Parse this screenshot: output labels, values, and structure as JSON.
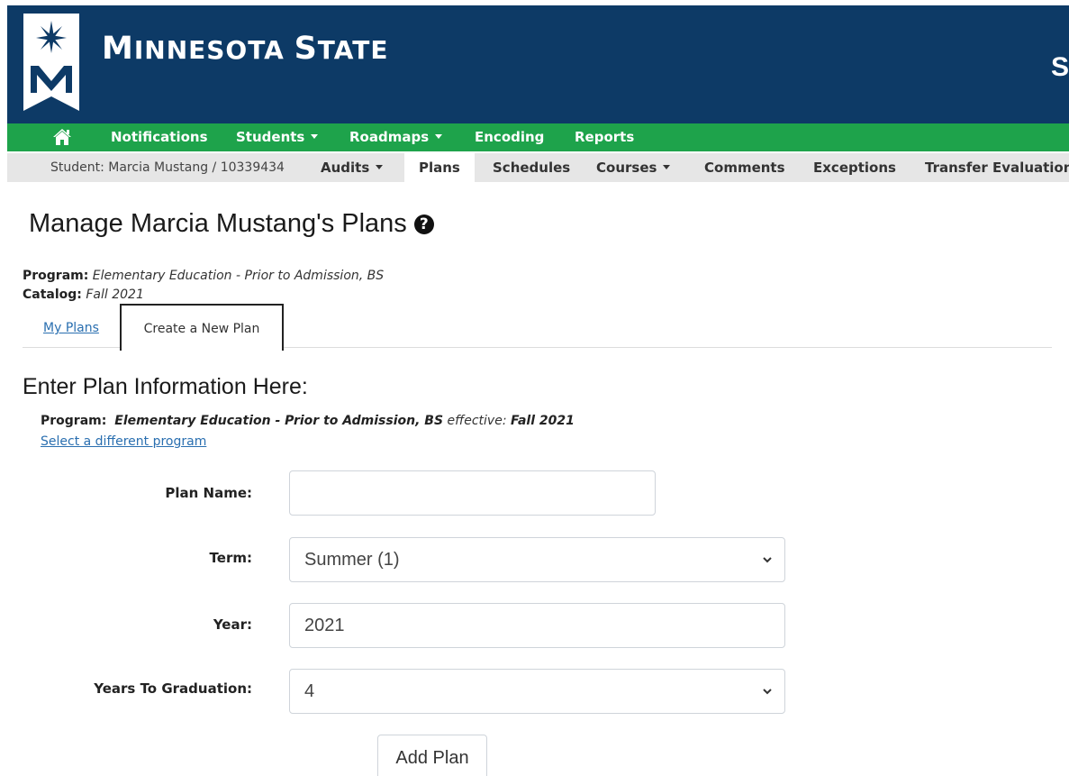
{
  "brand": {
    "name_first": "M",
    "name_rest": "INNESOTA ",
    "name_second": "S",
    "name_second_rest": "TATE",
    "edge_glyph": "S"
  },
  "green_nav": {
    "items": [
      {
        "label": "Notifications",
        "has_menu": false
      },
      {
        "label": "Students",
        "has_menu": true
      },
      {
        "label": "Roadmaps",
        "has_menu": true
      },
      {
        "label": "Encoding",
        "has_menu": false
      },
      {
        "label": "Reports",
        "has_menu": false
      }
    ]
  },
  "sub_nav": {
    "student": "Student: Marcia Mustang / 10339434",
    "items": [
      {
        "label": "Audits",
        "has_menu": true
      },
      {
        "label": "Plans",
        "active": true
      },
      {
        "label": "Schedules"
      },
      {
        "label": "Courses",
        "has_menu": true
      },
      {
        "label": "Comments"
      },
      {
        "label": "Exceptions"
      },
      {
        "label": "Transfer Evaluations"
      }
    ]
  },
  "page": {
    "title": "Manage Marcia Mustang's Plans",
    "help_glyph": "?",
    "program_label": "Program:",
    "program_value": "Elementary Education - Prior to Admission, BS",
    "catalog_label": "Catalog:",
    "catalog_value": "Fall 2021"
  },
  "tabs": {
    "my_plans": "My Plans",
    "create": "Create a New Plan"
  },
  "form": {
    "section_title": "Enter Plan Information Here:",
    "program_label": "Program:",
    "program_value": "Elementary Education - Prior to Admission, BS",
    "effective_label": "effective:",
    "effective_value": "Fall 2021",
    "change_program": "Select a different program",
    "plan_name_label": "Plan Name:",
    "plan_name_value": "",
    "term_label": "Term:",
    "term_value": "Summer (1)",
    "year_label": "Year:",
    "year_value": "2021",
    "ytg_label": "Years To Graduation:",
    "ytg_value": "4",
    "submit": "Add Plan"
  }
}
